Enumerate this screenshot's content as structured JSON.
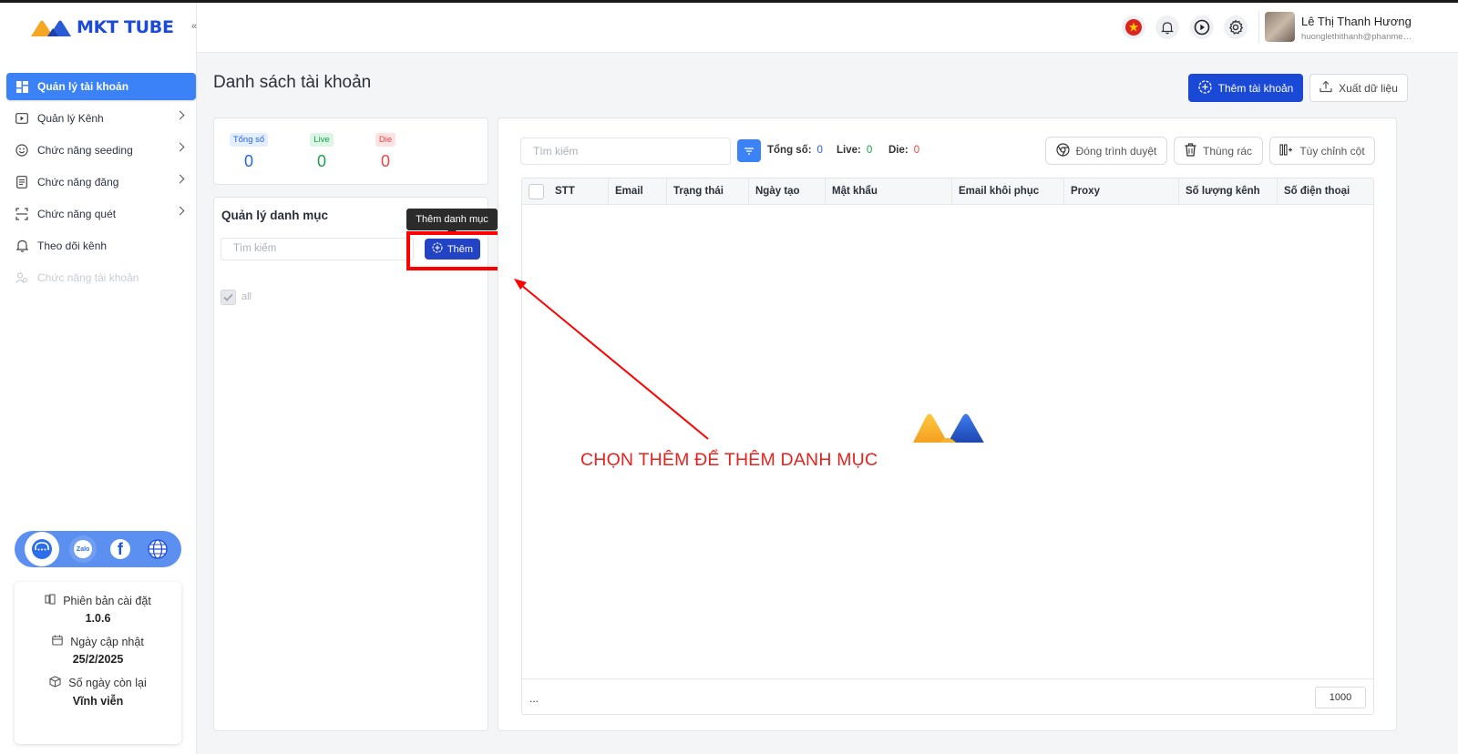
{
  "app": {
    "logo_text": "MKT TUBE"
  },
  "sidebar": {
    "collapse_icon": "«",
    "items": [
      {
        "label": "Quản lý tài khoản",
        "icon": "grid-icon",
        "active": true
      },
      {
        "label": "Quản lý Kênh",
        "icon": "play-square-icon"
      },
      {
        "label": "Chức năng seeding",
        "icon": "smile-icon"
      },
      {
        "label": "Chức năng đăng",
        "icon": "document-icon"
      },
      {
        "label": "Chức năng quét",
        "icon": "scan-icon"
      },
      {
        "label": "Theo dõi kênh",
        "icon": "bell-icon"
      },
      {
        "label": "Chức năng tài khoản",
        "icon": "users-icon",
        "disabled": true
      }
    ],
    "social": {
      "zalo": "Zalo",
      "facebook": "f"
    },
    "info": {
      "version_label": "Phiên bản cài đặt",
      "version_value": "1.0.6",
      "update_label": "Ngày cập nhật",
      "update_value": "25/2/2025",
      "days_label": "Số ngày còn lại",
      "days_value": "Vĩnh viễn"
    }
  },
  "header": {
    "user_name": "Lê Thị Thanh Hương",
    "user_email": "huonglethithanh@phanmemmkt.vn"
  },
  "page": {
    "title": "Danh sách tài khoản",
    "add_account": "Thêm tài khoản",
    "export": "Xuất dữ liệu"
  },
  "stats": {
    "total_label": "Tổng số",
    "total_value": "0",
    "live_label": "Live",
    "live_value": "0",
    "die_label": "Die",
    "die_value": "0"
  },
  "category": {
    "title": "Quản lý danh mục",
    "tooltip": "Thêm danh mục",
    "search_placeholder": "Tìm kiếm",
    "add_button": "Thêm",
    "all_label": "all"
  },
  "table": {
    "search_placeholder": "Tìm kiếm",
    "total_label": "Tổng số:",
    "total_value": "0",
    "live_label": "Live:",
    "live_value": "0",
    "die_label": "Die:",
    "die_value": "0",
    "close_browser": "Đóng trình duyệt",
    "trash": "Thùng rác",
    "customize_columns": "Tùy chỉnh cột",
    "columns": [
      "STT",
      "Email",
      "Trạng thái",
      "Ngày tạo",
      "Mật khẩu",
      "Email khôi phục",
      "Proxy",
      "Số lượng kênh",
      "Số điện thoại"
    ],
    "footer_ellipsis": "...",
    "page_size": "1000"
  },
  "annotation": {
    "text": "CHỌN THÊM ĐỂ THÊM DANH MỤC"
  },
  "colors": {
    "primary": "#1a49d6",
    "accent": "#3b82f6",
    "live": "#16a34a",
    "die": "#ef4444",
    "annotation": "#e4231f"
  }
}
